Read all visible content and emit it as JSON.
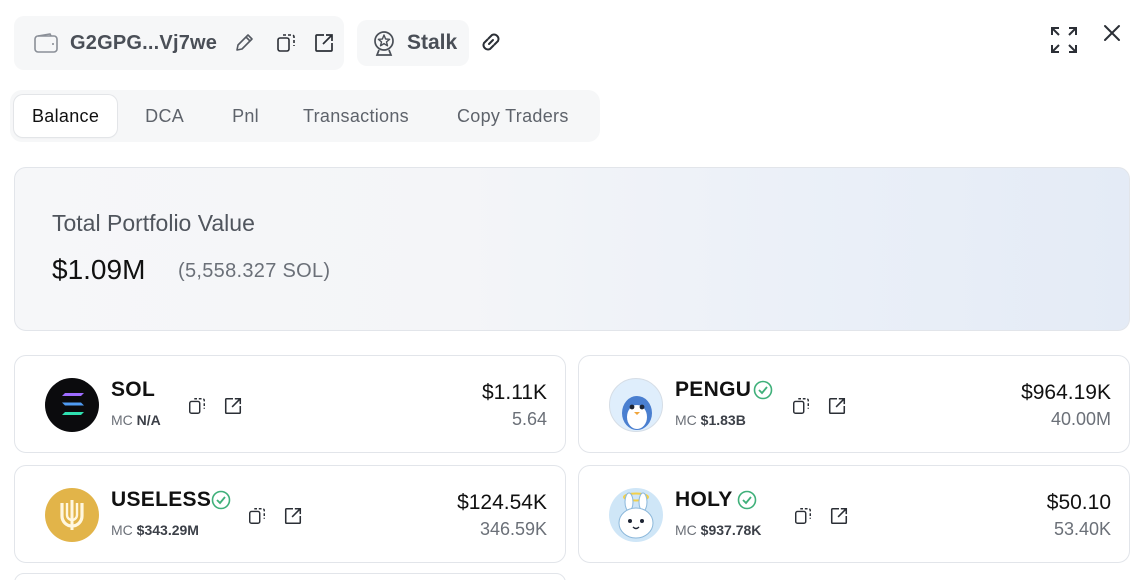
{
  "header": {
    "wallet_address": "G2GPG...Vj7we",
    "stalk_label": "Stalk"
  },
  "tabs": [
    {
      "label": "Balance",
      "active": true
    },
    {
      "label": "DCA",
      "active": false
    },
    {
      "label": "Pnl",
      "active": false
    },
    {
      "label": "Transactions",
      "active": false
    },
    {
      "label": "Copy Traders",
      "active": false
    }
  ],
  "portfolio": {
    "title": "Total Portfolio Value",
    "value": "$1.09M",
    "sol_value": "(5,558.327 SOL)"
  },
  "tokens": [
    {
      "symbol": "SOL",
      "verified": false,
      "mc_label": "MC",
      "mc_value": "N/A",
      "usd": "$1.11K",
      "amount": "5.64",
      "logo": "solana-logo"
    },
    {
      "symbol": "PENGU",
      "verified": true,
      "mc_label": "MC",
      "mc_value": "$1.83B",
      "usd": "$964.19K",
      "amount": "40.00M",
      "logo": "pengu-logo"
    },
    {
      "symbol": "USELESS",
      "verified": true,
      "mc_label": "MC",
      "mc_value": "$343.29M",
      "usd": "$124.54K",
      "amount": "346.59K",
      "logo": "useless-logo"
    },
    {
      "symbol": "HOLY",
      "verified": true,
      "mc_label": "MC",
      "mc_value": "$937.78K",
      "usd": "$50.10",
      "amount": "53.40K",
      "logo": "holy-logo"
    }
  ],
  "colors": {
    "verified_green": "#3fb07a",
    "text_primary": "#111111",
    "text_muted": "#6b7078"
  },
  "icons": [
    "wallet-icon",
    "pencil-icon",
    "copy-icon",
    "external-link-icon",
    "stalk-icon",
    "link-icon",
    "expand-icon",
    "close-icon",
    "verified-icon"
  ]
}
